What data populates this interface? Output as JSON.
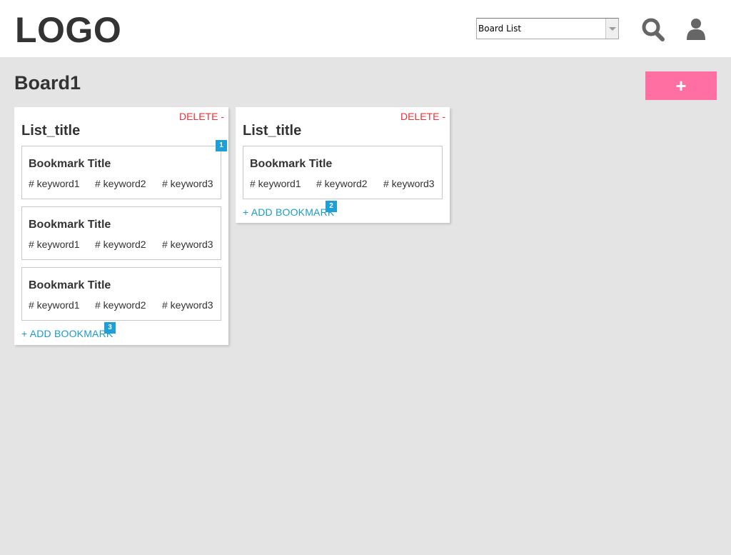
{
  "header": {
    "logo": "LOGO",
    "board_select": {
      "value": "Board List"
    },
    "icons": {
      "search": "search-icon",
      "user": "user-icon"
    }
  },
  "board": {
    "title": "Board1",
    "add_label": "+",
    "add_color": "#ff6fa2"
  },
  "lists": [
    {
      "title": "List_title",
      "delete_label": "DELETE -",
      "add_bookmark_label": "+ ADD BOOKMARK",
      "bookmarks": [
        {
          "title": "Bookmark Title",
          "keywords": [
            "# keyword1",
            "# keyword2",
            "# keyword3"
          ]
        },
        {
          "title": "Bookmark Title",
          "keywords": [
            "# keyword1",
            "# keyword2",
            "# keyword3"
          ]
        },
        {
          "title": "Bookmark Title",
          "keywords": [
            "# keyword1",
            "# keyword2",
            "# keyword3"
          ]
        }
      ]
    },
    {
      "title": "List_title",
      "delete_label": "DELETE -",
      "add_bookmark_label": "+ ADD BOOKMARK",
      "bookmarks": [
        {
          "title": "Bookmark Title",
          "keywords": [
            "# keyword1",
            "# keyword2",
            "# keyword3"
          ]
        }
      ]
    }
  ],
  "badges": [
    "1",
    "2",
    "3"
  ],
  "colors": {
    "delete": "#e8323c",
    "link": "#1a9cc7",
    "badge": "#1e9fd8"
  }
}
